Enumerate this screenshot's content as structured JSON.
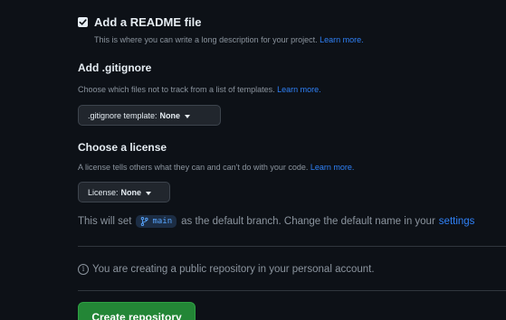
{
  "readme": {
    "label": "Add a README file",
    "checked": true,
    "description": "This is where you can write a long description for your project.",
    "learn_more": "Learn more."
  },
  "gitignore": {
    "title": "Add .gitignore",
    "description": "Choose which files not to track from a list of templates.",
    "learn_more": "Learn more.",
    "dropdown_label": ".gitignore template:",
    "dropdown_value": "None"
  },
  "license": {
    "title": "Choose a license",
    "description": "A license tells others what they can and can't do with your code.",
    "learn_more": "Learn more.",
    "dropdown_label": "License:",
    "dropdown_value": "None"
  },
  "branch_notice": {
    "prefix": "This will set",
    "branch": "main",
    "suffix": "as the default branch. Change the default name in your",
    "settings_link": "settings"
  },
  "info_notice": {
    "text": "You are creating a public repository in your personal account."
  },
  "submit": {
    "label": "Create repository"
  },
  "colors": {
    "background": "#0d1117",
    "link": "#2f81f7",
    "primary_button": "#238636",
    "muted_text": "#8b949e"
  }
}
